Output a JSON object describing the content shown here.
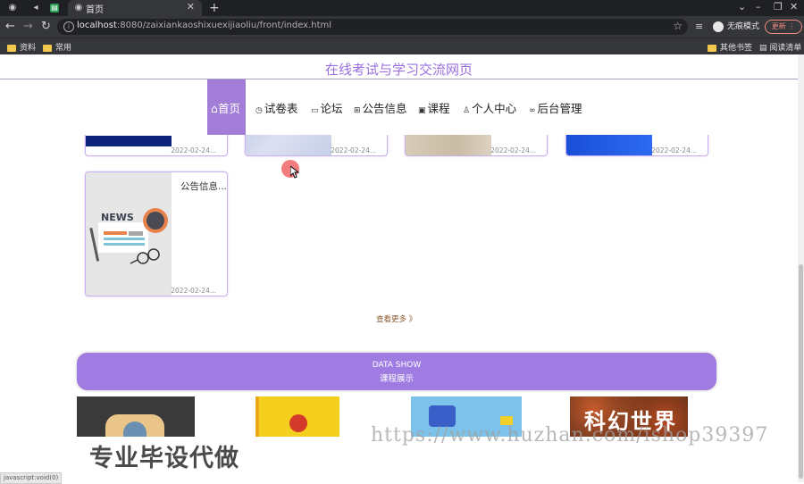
{
  "browser": {
    "tab_title": "首页",
    "url_host": "localhost",
    "url_path": ":8080/zaixiankaoshixuexijiaoliu/front/index.html",
    "incognito_label": "无痕模式",
    "update_label": "更新",
    "bookmarks": [
      "资料",
      "常用"
    ],
    "bookmarks_right": [
      "其他书签",
      "阅读清单"
    ]
  },
  "site": {
    "title": "在线考试与学习交流网页"
  },
  "nav": {
    "items": [
      {
        "label": "首页",
        "icon": "home-icon",
        "glyph": "⌂"
      },
      {
        "label": "试卷表",
        "icon": "clock-icon",
        "glyph": "◷"
      },
      {
        "label": "论坛",
        "icon": "forum-icon",
        "glyph": "▭"
      },
      {
        "label": "公告信息",
        "icon": "grid-icon",
        "glyph": "⊞"
      },
      {
        "label": "课程",
        "icon": "book-icon",
        "glyph": "▣"
      },
      {
        "label": "个人中心",
        "icon": "user-icon",
        "glyph": "♙"
      },
      {
        "label": "后台管理",
        "icon": "link-icon",
        "glyph": "∞"
      }
    ]
  },
  "news_cards_top": [
    {
      "date": "2022-02-24..."
    },
    {
      "date": "2022-02-24..."
    },
    {
      "date": "2022-02-24..."
    },
    {
      "date": "2022-02-24..."
    }
  ],
  "news_card": {
    "title": "公告信息...",
    "date": "2022-02-24...",
    "image_text": "NEWS"
  },
  "more_label": "查看更多 》",
  "banner": {
    "en": "DATA SHOW",
    "zh": "课程展示"
  },
  "product_text": "科幻世界",
  "watermarks": {
    "url": "https://www.huzhan.com/ishop39397",
    "zh": "专业毕设代做"
  },
  "status_url": "javascript:void(0)",
  "colors": {
    "accent": "#a27ed8",
    "banner": "#9f7ce2",
    "title": "#9b6fe0"
  }
}
